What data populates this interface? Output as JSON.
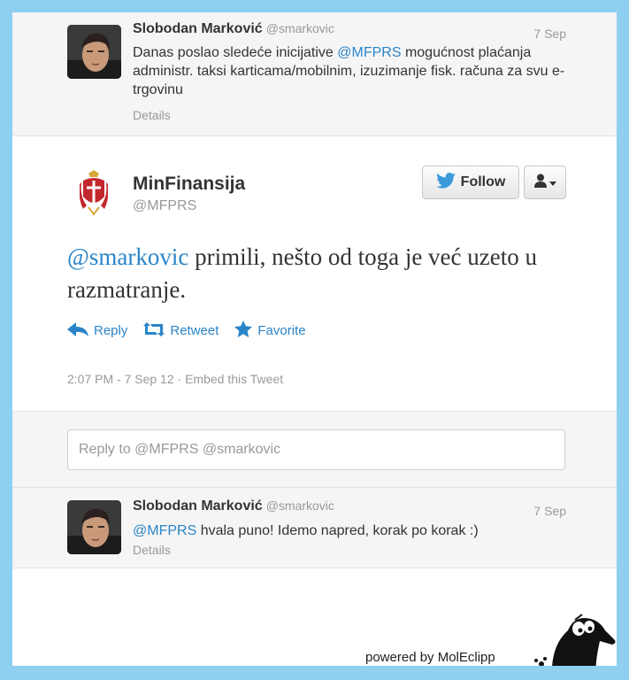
{
  "tweet_top": {
    "author_name": "Slobodan Marković",
    "author_handle": "@smarkovic",
    "date": "7 Sep",
    "text_before": "Danas poslao sledeće inicijative ",
    "mention": "@MFPRS",
    "text_after": " mogućnost plaćanja administr. taksi karticama/mobilnim, izuzimanje fisk. računa za svu e-trgovinu",
    "details_label": "Details"
  },
  "main_tweet": {
    "author_name": "MinFinansija",
    "author_handle": "@MFPRS",
    "follow_label": "Follow",
    "mention": "@smarkovic",
    "text": " primili, nešto od toga je već uzeto u razmatranje.",
    "actions": {
      "reply": "Reply",
      "retweet": "Retweet",
      "favorite": "Favorite"
    },
    "timestamp": "2:07 PM - 7 Sep 12",
    "separator": "·",
    "embed_label": "Embed this Tweet"
  },
  "reply_box": {
    "placeholder": "Reply to @MFPRS @smarkovic"
  },
  "tweet_bottom": {
    "author_name": "Slobodan Marković",
    "author_handle": "@smarkovic",
    "date": "7 Sep",
    "mention": "@MFPRS",
    "text": " hvala puno! Idemo napred, korak po korak :)",
    "details_label": "Details"
  },
  "footer": {
    "powered_by": "powered by MolEclipp"
  },
  "colors": {
    "border": "#8fd0f0",
    "link": "#2a85c8",
    "muted": "#999999"
  }
}
